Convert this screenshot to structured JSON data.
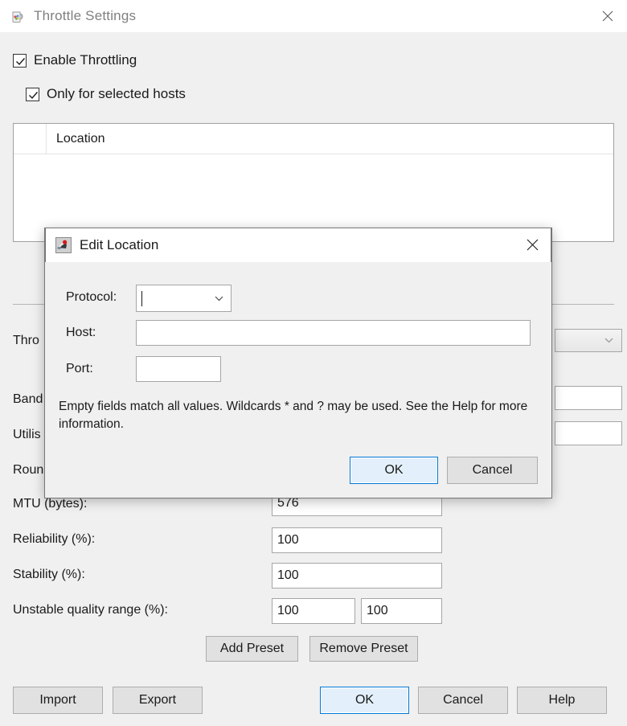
{
  "window": {
    "title": "Throttle Settings",
    "icon": "pitcher-icon",
    "close_label": "✕"
  },
  "options": {
    "enable_throttling": {
      "label": "Enable Throttling",
      "checked": true
    },
    "only_selected_hosts": {
      "label": "Only for selected hosts",
      "checked": true
    }
  },
  "location_list": {
    "columns": [
      "",
      "Location"
    ],
    "rows": []
  },
  "settings": [
    {
      "label": "Thro",
      "value": ""
    },
    {
      "label": "Band",
      "value": ""
    },
    {
      "label": "Utilis",
      "value": ""
    },
    {
      "label": "Roun",
      "value": ""
    },
    {
      "label": "MTU (bytes):",
      "value": "576"
    },
    {
      "label": "Reliability (%):",
      "value": "100"
    },
    {
      "label": "Stability (%):",
      "value": "100"
    },
    {
      "label": "Unstable quality range (%):",
      "value": "100",
      "value2": "100"
    }
  ],
  "preset_buttons": {
    "add": "Add Preset",
    "remove": "Remove Preset"
  },
  "footer_buttons": {
    "import": "Import",
    "export": "Export",
    "ok": "OK",
    "cancel": "Cancel",
    "help": "Help"
  },
  "dialog": {
    "title": "Edit Location",
    "icon": "rocket-icon",
    "close_label": "✕",
    "fields": {
      "protocol": {
        "label": "Protocol:",
        "value": ""
      },
      "host": {
        "label": "Host:",
        "value": ""
      },
      "port": {
        "label": "Port:",
        "value": ""
      }
    },
    "help_text": "Empty fields match all values. Wildcards * and ? may be used. See the Help for more information.",
    "buttons": {
      "ok": "OK",
      "cancel": "Cancel"
    }
  },
  "colors": {
    "window_bg": "#f0f0f0",
    "titlebar_bg": "#ffffff",
    "accent": "#0078d7",
    "text": "#1a1a1a",
    "title_text": "#808080",
    "border": "#a6a6a6"
  }
}
